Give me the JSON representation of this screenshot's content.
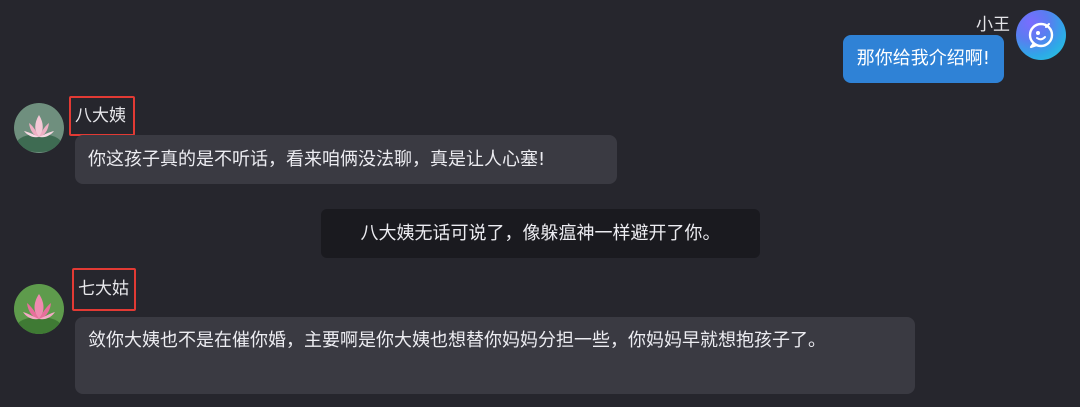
{
  "messages": {
    "self": {
      "sender": "小王",
      "text": "那你给我介绍啊!",
      "avatar_icon": "chat-bubble-icon",
      "bubble_color": "#2f82d6"
    },
    "m1": {
      "sender": "八大姨",
      "text": "你这孩子真的是不听话，看来咱俩没法聊，真是让人心塞!",
      "avatar_icon": "lotus-avatar"
    },
    "system": {
      "text": "八大姨无话可说了，像躲瘟神一样避开了你。"
    },
    "m2": {
      "sender": "七大姑",
      "text": "敛你大姨也不是在催你婚，主要啊是你大姨也想替你妈妈分担一些，你妈妈早就想抱孩子了。",
      "avatar_icon": "lotus-avatar"
    }
  },
  "colors": {
    "background": "#26262d",
    "bubble": "#3a3a42",
    "system_bubble": "#1a1a1f",
    "highlight_box": "#e23a34"
  }
}
